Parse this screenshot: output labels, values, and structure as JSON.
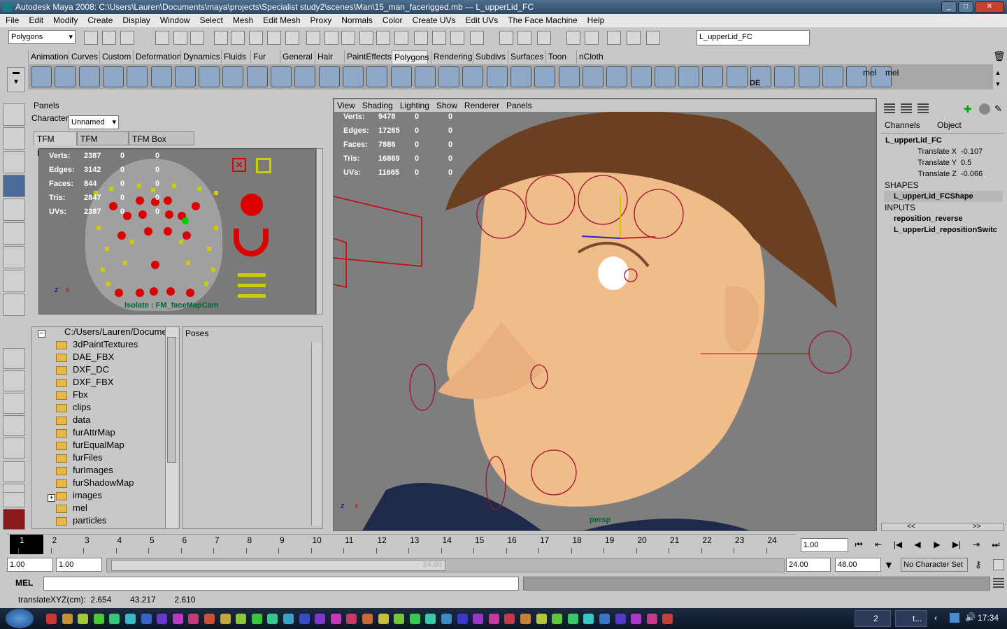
{
  "window": {
    "title": "Autodesk Maya 2008: C:\\Users\\Lauren\\Documents\\maya\\projects\\Specialist study2\\scenes\\Man\\15_man_facerigged.mb  ---  L_upperLid_FC"
  },
  "menu": [
    "File",
    "Edit",
    "Modify",
    "Create",
    "Display",
    "Window",
    "Select",
    "Mesh",
    "Edit Mesh",
    "Proxy",
    "Normals",
    "Color",
    "Create UVs",
    "Edit UVs",
    "The Face Machine",
    "Help"
  ],
  "statusline": {
    "mode": "Polygons",
    "selection_field": "L_upperLid_FC"
  },
  "shelf_tabs": [
    "Animation",
    "Curves",
    "Custom",
    "Deformation",
    "Dynamics",
    "Fluids",
    "Fur",
    "General",
    "Hair",
    "PaintEffects",
    "Polygons",
    "Rendering",
    "Subdivs",
    "Surfaces",
    "Toon",
    "nCloth"
  ],
  "shelf_active": "Polygons",
  "shelf_icon_labels": [
    "DE",
    "mel",
    "mel"
  ],
  "left_panel": {
    "title": "Panels",
    "character_label": "Character",
    "character_value": "Unnamed",
    "tabs": [
      "TFM Maps",
      "TFM Outliner",
      "TFM Box Controls"
    ],
    "stats": [
      {
        "label": "Verts:",
        "v1": "2387",
        "v2": "0",
        "v3": "0"
      },
      {
        "label": "Edges:",
        "v1": "3142",
        "v2": "0",
        "v3": "0"
      },
      {
        "label": "Faces:",
        "v1": "844",
        "v2": "0",
        "v3": "0"
      },
      {
        "label": "Tris:",
        "v1": "2847",
        "v2": "0",
        "v3": "0"
      },
      {
        "label": "UVs:",
        "v1": "2387",
        "v2": "0",
        "v3": "0"
      }
    ],
    "isolate_text": "Isolate : FM_faceMapCam",
    "axis_z": "z",
    "axis_x": "x"
  },
  "browser": {
    "path": "C:/Users/Lauren/Docume",
    "folders": [
      "3dPaintTextures",
      "DAE_FBX",
      "DXF_DC",
      "DXF_FBX",
      "Fbx",
      "clips",
      "data",
      "furAttrMap",
      "furEqualMap",
      "furFiles",
      "furImages",
      "furShadowMap",
      "images",
      "mel",
      "particles"
    ]
  },
  "poses": {
    "title": "Poses"
  },
  "viewport": {
    "menu": [
      "View",
      "Shading",
      "Lighting",
      "Show",
      "Renderer",
      "Panels"
    ],
    "stats": [
      {
        "label": "Verts:",
        "v1": "9478",
        "v2": "0",
        "v3": "0"
      },
      {
        "label": "Edges:",
        "v1": "17265",
        "v2": "0",
        "v3": "0"
      },
      {
        "label": "Faces:",
        "v1": "7886",
        "v2": "0",
        "v3": "0"
      },
      {
        "label": "Tris:",
        "v1": "16869",
        "v2": "0",
        "v3": "0"
      },
      {
        "label": "UVs:",
        "v1": "11665",
        "v2": "0",
        "v3": "0"
      }
    ],
    "camera": "persp",
    "axis_z": "z",
    "axis_x": "x"
  },
  "channel_box": {
    "tabs": [
      "Channels",
      "Object"
    ],
    "node": "L_upperLid_FC",
    "attrs": [
      {
        "name": "Translate X",
        "value": "-0.107"
      },
      {
        "name": "Translate Y",
        "value": "0.5"
      },
      {
        "name": "Translate Z",
        "value": "-0.066"
      }
    ],
    "shapes_header": "SHAPES",
    "shape": "L_upperLid_FCShape",
    "inputs_header": "INPUTS",
    "inputs": [
      "reposition_reverse",
      "L_upperLid_repositionSwitc"
    ],
    "scroll_left": "<<",
    "scroll_right": ">>"
  },
  "timeline": {
    "ticks": [
      "1",
      "2",
      "3",
      "4",
      "5",
      "6",
      "7",
      "8",
      "9",
      "10",
      "11",
      "12",
      "13",
      "14",
      "15",
      "16",
      "17",
      "18",
      "19",
      "20",
      "21",
      "22",
      "23",
      "24"
    ],
    "current_frame": "1.00"
  },
  "range": {
    "start": "1.00",
    "anim_start": "1.00",
    "range_mark": "24.00",
    "end": "24.00",
    "anim_end": "48.00",
    "character_set": "No Character Set"
  },
  "mel": {
    "label": "MEL"
  },
  "help": {
    "text": "translateXYZ(cm):  2.654        43.217        2.610"
  },
  "taskbar": {
    "group_count": "2",
    "task_label": "t...",
    "clock": "17:34"
  }
}
